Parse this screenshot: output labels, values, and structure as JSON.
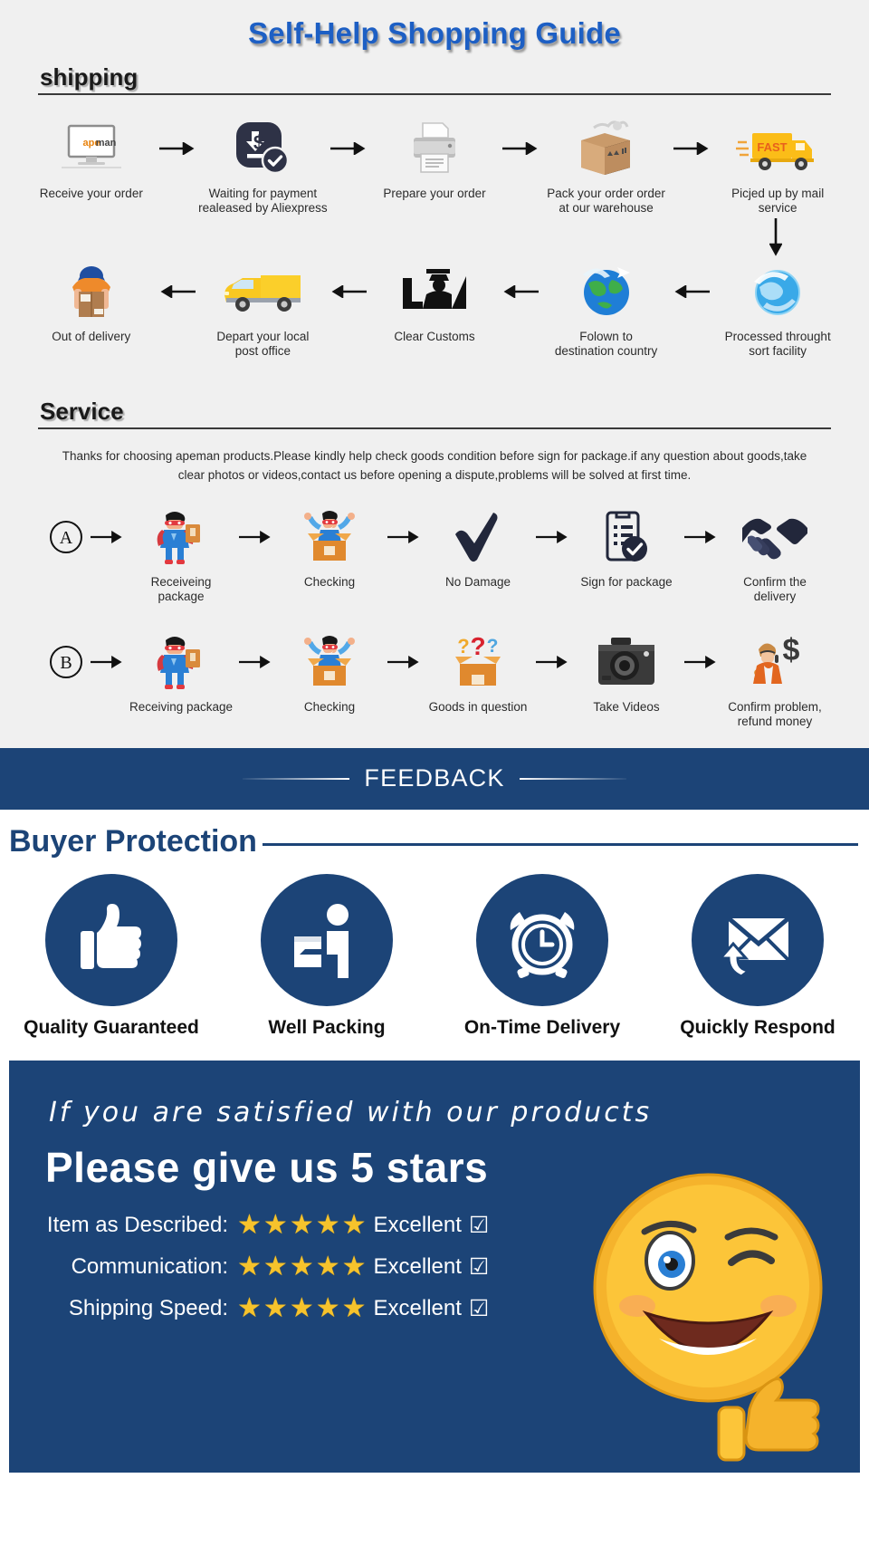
{
  "header": {
    "main_title": "Self-Help Shopping Guide",
    "accent_blue": "#1d5fc4",
    "brand_navy": "#1c4477"
  },
  "shipping": {
    "section_label": "shipping",
    "row1": [
      {
        "icon": "monitor-order-icon",
        "label": "Receive your order"
      },
      {
        "icon": "payment-dollar-icon",
        "label": "Waiting for payment\nrealeased by Aliexpress"
      },
      {
        "icon": "printer-icon",
        "label": "Prepare your order"
      },
      {
        "icon": "package-box-icon",
        "label": "Pack your order order\nat our warehouse"
      },
      {
        "icon": "fast-truck-icon",
        "label": "Picjed up by mail service"
      }
    ],
    "row2": [
      {
        "icon": "delivery-man-box-icon",
        "label": "Out of delivery"
      },
      {
        "icon": "yellow-van-icon",
        "label": "Depart your local\npost office"
      },
      {
        "icon": "customs-officer-icon",
        "label": "Clear Customs"
      },
      {
        "icon": "globe-plane-icon",
        "label": "Folown to\ndestination country"
      },
      {
        "icon": "sort-facility-globe-icon",
        "label": "Processed throught\nsort facility"
      }
    ]
  },
  "service": {
    "section_label": "Service",
    "note": "Thanks for choosing apeman products.Please kindly help check goods condition before sign for package.if any question about goods,take clear photos or videos,contact us before opening a dispute,problems will be solved at first time.",
    "row_a": {
      "badge": "A",
      "steps": [
        {
          "icon": "hero-with-package-icon",
          "label": "Receiveing package"
        },
        {
          "icon": "happy-man-in-box-icon",
          "label": "Checking"
        },
        {
          "icon": "checkmark-icon",
          "label": "No Damage"
        },
        {
          "icon": "clipboard-check-icon",
          "label": "Sign for package"
        },
        {
          "icon": "handshake-icon",
          "label": "Confirm the delivery"
        }
      ]
    },
    "row_b": {
      "badge": "B",
      "steps": [
        {
          "icon": "hero-with-package-icon",
          "label": "Receiving package"
        },
        {
          "icon": "happy-man-in-box-icon",
          "label": "Checking"
        },
        {
          "icon": "question-box-icon",
          "label": "Goods in question"
        },
        {
          "icon": "camera-icon",
          "label": "Take Videos"
        },
        {
          "icon": "agent-dollar-icon",
          "label": "Confirm problem,\nrefund money"
        }
      ]
    }
  },
  "feedback": {
    "title": "FEEDBACK"
  },
  "buyer_protection": {
    "title": "Buyer Protection",
    "items": [
      {
        "icon": "thumbs-up-icon",
        "label": "Quality Guaranteed"
      },
      {
        "icon": "person-carry-box-icon",
        "label": "Well Packing"
      },
      {
        "icon": "alarm-clock-icon",
        "label": "On-Time Delivery"
      },
      {
        "icon": "envelope-reply-icon",
        "label": "Quickly Respond"
      }
    ]
  },
  "rating_panel": {
    "line1": "If you are satisfied with our products",
    "line2": "Please give us 5 stars",
    "star_color": "#f6c32c",
    "rows": [
      {
        "name": "Item as Described:",
        "stars": 5,
        "word": "Excellent",
        "checked": true
      },
      {
        "name": "Communication:",
        "stars": 5,
        "word": "Excellent",
        "checked": true
      },
      {
        "name": "Shipping Speed:",
        "stars": 5,
        "word": "Excellent",
        "checked": true
      }
    ],
    "emoji": "winking-smiley-thumbs-up-icon"
  }
}
